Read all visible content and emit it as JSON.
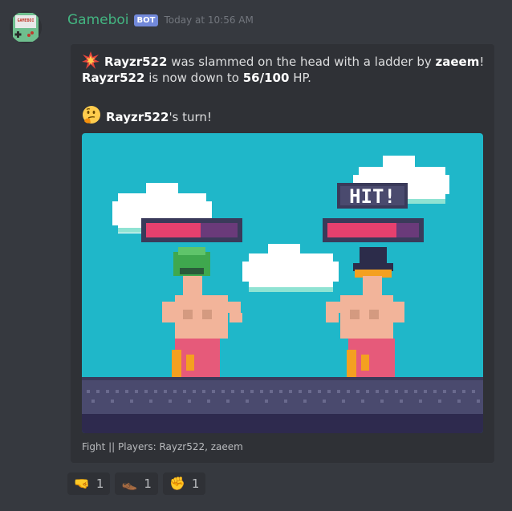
{
  "message": {
    "username": "Gameboi",
    "bot_tag": "BOT",
    "timestamp": "Today at 10:56 AM",
    "avatar_label": "GAMEBOI"
  },
  "embed": {
    "line1": {
      "actor": "Rayzr522",
      "text": " was slammed on the head with a ladder by ",
      "attacker": "zaeem",
      "end": "!"
    },
    "line2": {
      "actor": "Rayzr522",
      "text": " is now down to ",
      "hp": "56/100",
      "end": " HP."
    },
    "turn": {
      "actor": "Rayzr522",
      "text": "'s turn!"
    },
    "game_image": {
      "hit_text": "HIT!",
      "player1_health": 0.6,
      "player2_health": 0.75
    },
    "footer": "Fight || Players: Rayzr522, zaeem"
  },
  "reactions": [
    {
      "emoji": "🤜",
      "count": "1",
      "icon": "fist-right-icon"
    },
    {
      "emoji": "👞",
      "count": "1",
      "icon": "shoe-icon"
    },
    {
      "emoji": "✊",
      "count": "1",
      "icon": "raised-fist-icon"
    }
  ],
  "colors": {
    "bg": "#36393f",
    "embed_bg": "#2f3136",
    "username": "#43b581",
    "bot_tag": "#7289da",
    "sky": "#1fb7c9",
    "ground": "#4a4a6e"
  }
}
